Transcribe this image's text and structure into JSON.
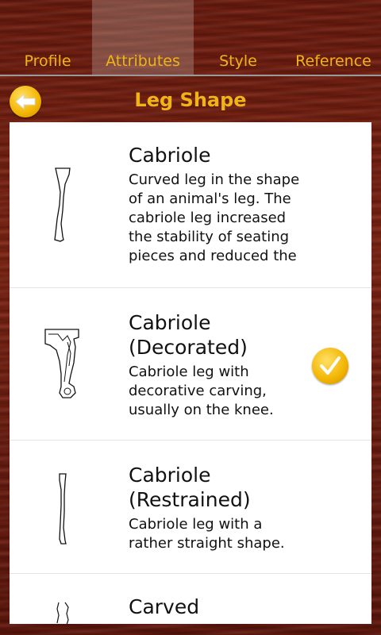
{
  "accent_color": "#f0b417",
  "tabs": [
    {
      "label": "Profile",
      "active": false
    },
    {
      "label": "Attributes",
      "active": true
    },
    {
      "label": "Style",
      "active": false
    },
    {
      "label": "Reference",
      "active": false
    }
  ],
  "header": {
    "title": "Leg Shape",
    "back_icon": "back-arrow-icon"
  },
  "items": [
    {
      "title": "Cabriole",
      "description": "Curved leg in the shape of an animal's leg. The cabriole leg increased the stability of seating pieces and reduced the",
      "selected": false
    },
    {
      "title": "Cabriole (Decorated)",
      "description": "Cabriole leg with decorative carving, usually on the knee.",
      "selected": true
    },
    {
      "title": "Cabriole (Restrained)",
      "description": "Cabriole leg with a rather straight shape.",
      "selected": false
    },
    {
      "title": "Carved",
      "description": "",
      "selected": false
    }
  ]
}
